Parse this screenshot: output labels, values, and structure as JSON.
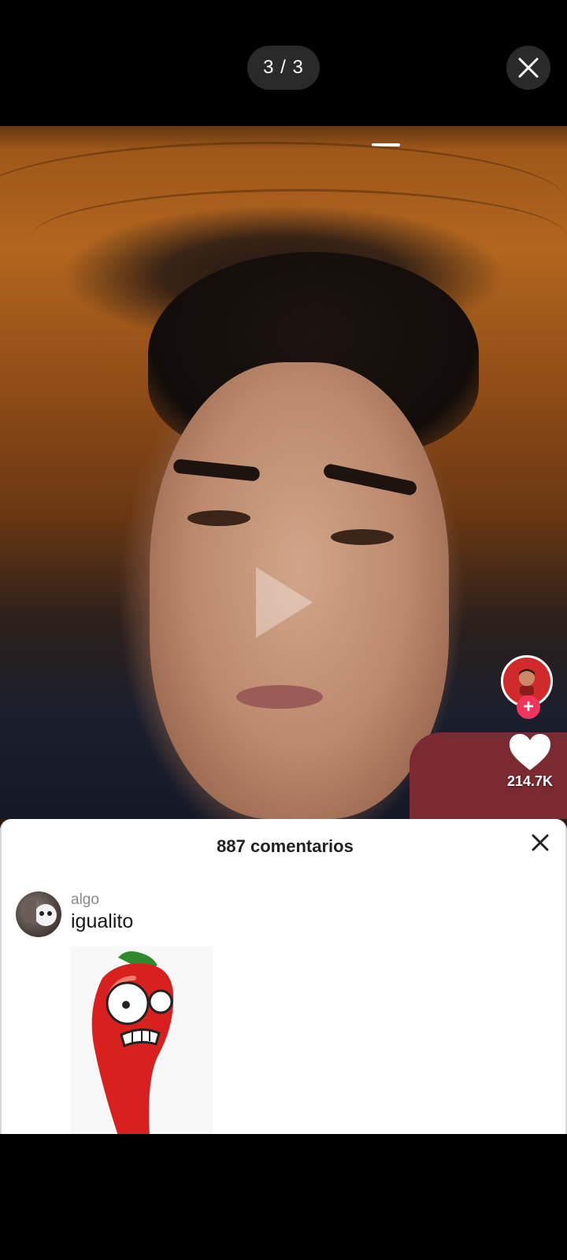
{
  "viewer": {
    "counter": "3 / 3",
    "close_icon": "close-icon"
  },
  "video": {
    "like_count": "214.7K",
    "icons": [
      "play-icon",
      "heart-icon",
      "plus-icon",
      "creator-avatar"
    ]
  },
  "comments": {
    "title": "887 comentarios",
    "items": [
      {
        "user": "algo",
        "text": "igualito",
        "sticker": "red-chili-pepper-sticker"
      }
    ]
  },
  "colors": {
    "background": "#000000",
    "pill": "#2a2a2a",
    "follow_plus": "#f0345b",
    "sheet": "#ffffff"
  }
}
